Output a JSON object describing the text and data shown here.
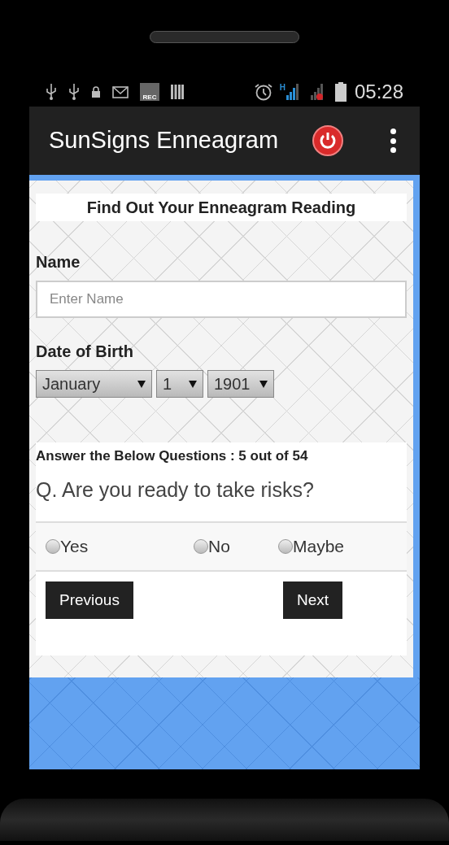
{
  "status_bar": {
    "rec_label": "REC",
    "network_type": "H",
    "time": "05:28"
  },
  "app_bar": {
    "title": "SunSigns Enneagram"
  },
  "form": {
    "heading": "Find Out Your Enneagram Reading",
    "name_label": "Name",
    "name_field": {
      "placeholder": "Enter Name"
    },
    "dob_label": "Date of Birth",
    "dob_selects": [
      {
        "value": "January"
      },
      {
        "value": "1"
      },
      {
        "value": "1901"
      }
    ]
  },
  "quiz": {
    "progress": "Answer the Below Questions : 5 out of 54",
    "question": "Q. Are you ready to take risks?",
    "options": [
      {
        "label": "Yes",
        "selected": false
      },
      {
        "label": "No",
        "selected": false
      },
      {
        "label": "Maybe",
        "selected": false
      }
    ],
    "buttons": [
      {
        "label": "Previous"
      },
      {
        "label": "Next"
      }
    ]
  }
}
